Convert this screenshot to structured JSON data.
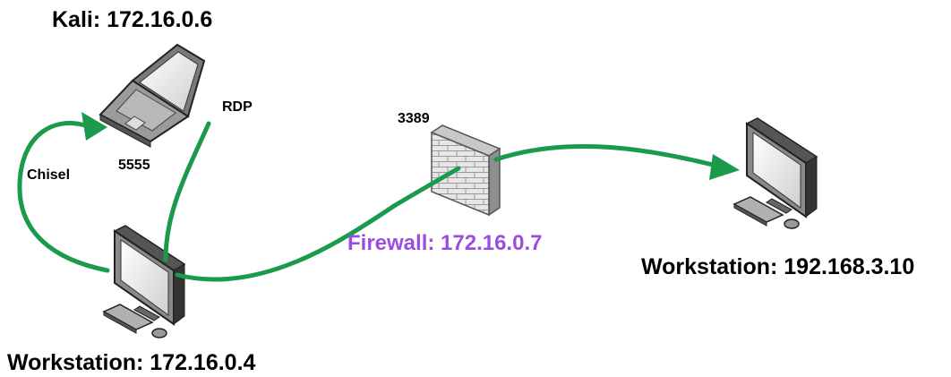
{
  "nodes": {
    "kali": {
      "label": "Kali: 172.16.0.6",
      "icon": "laptop-icon"
    },
    "workstation_local": {
      "label": "Workstation: 172.16.0.4",
      "icon": "desktop-computer-icon"
    },
    "firewall": {
      "label": "Firewall: 172.16.0.7",
      "icon": "firewall-icon",
      "port": "3389"
    },
    "workstation_remote": {
      "label": "Workstation: 192.168.3.10",
      "icon": "desktop-computer-icon"
    }
  },
  "connections": {
    "chisel": {
      "label": "Chisel",
      "port": "5555"
    },
    "rdp": {
      "label": "RDP"
    }
  },
  "colors": {
    "connection": "#1a9a4a",
    "firewall_label": "#9b4de0",
    "text": "#000000"
  }
}
